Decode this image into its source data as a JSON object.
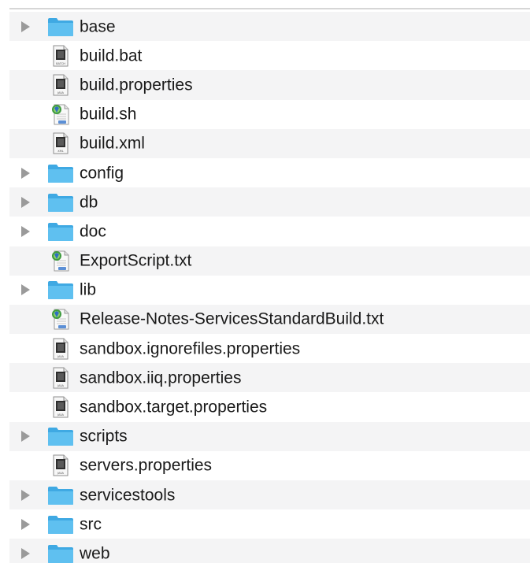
{
  "files": [
    {
      "name": "base",
      "kind": "folder",
      "icon": "folder-icon"
    },
    {
      "name": "build.bat",
      "kind": "file",
      "icon": "batch-file-icon",
      "badge": "BATCH"
    },
    {
      "name": "build.properties",
      "kind": "file",
      "icon": "java-file-icon",
      "badge": "JAVA"
    },
    {
      "name": "build.sh",
      "kind": "script",
      "icon": "script-file-icon"
    },
    {
      "name": "build.xml",
      "kind": "file",
      "icon": "xml-file-icon",
      "badge": "XML"
    },
    {
      "name": "config",
      "kind": "folder",
      "icon": "folder-icon"
    },
    {
      "name": "db",
      "kind": "folder",
      "icon": "folder-icon"
    },
    {
      "name": "doc",
      "kind": "folder",
      "icon": "folder-icon"
    },
    {
      "name": "ExportScript.txt",
      "kind": "script",
      "icon": "script-file-icon"
    },
    {
      "name": "lib",
      "kind": "folder",
      "icon": "folder-icon"
    },
    {
      "name": "Release-Notes-ServicesStandardBuild.txt",
      "kind": "script",
      "icon": "script-file-icon"
    },
    {
      "name": "sandbox.ignorefiles.properties",
      "kind": "file",
      "icon": "java-file-icon",
      "badge": "JAVA"
    },
    {
      "name": "sandbox.iiq.properties",
      "kind": "file",
      "icon": "java-file-icon",
      "badge": "JAVA"
    },
    {
      "name": "sandbox.target.properties",
      "kind": "file",
      "icon": "java-file-icon",
      "badge": "JAVA"
    },
    {
      "name": "scripts",
      "kind": "folder",
      "icon": "folder-icon"
    },
    {
      "name": "servers.properties",
      "kind": "file",
      "icon": "java-file-icon",
      "badge": "JAVA"
    },
    {
      "name": "servicestools",
      "kind": "folder",
      "icon": "folder-icon"
    },
    {
      "name": "src",
      "kind": "folder",
      "icon": "folder-icon"
    },
    {
      "name": "web",
      "kind": "folder",
      "icon": "folder-icon"
    }
  ],
  "colors": {
    "folder_front": "#5fc0f0",
    "folder_back": "#3fa9e3",
    "disclosure": "#9a9a9a",
    "alt_row": "#f4f4f5"
  }
}
